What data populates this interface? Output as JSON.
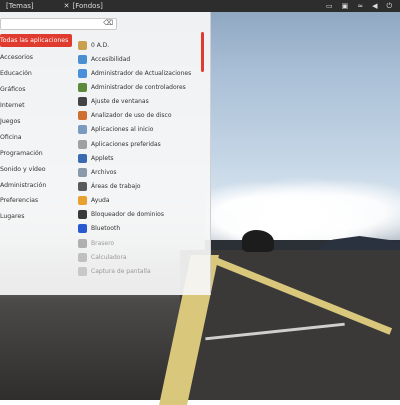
{
  "panel": {
    "tab1": "[Temas]",
    "tab2": "[Fondos]"
  },
  "menu": {
    "search_placeholder": "",
    "categories": [
      "Todas las aplicaciones",
      "Accesorios",
      "Educación",
      "Gráficos",
      "Internet",
      "Juegos",
      "Oficina",
      "Programación",
      "Sonido y vídeo",
      "Administración",
      "Preferencias",
      "Lugares"
    ],
    "apps": [
      {
        "label": "0 A.D.",
        "color": "#c8a050"
      },
      {
        "label": "Accesibilidad",
        "color": "#4a8fd0"
      },
      {
        "label": "Administrador de Actualizaciones",
        "color": "#4a90d9"
      },
      {
        "label": "Administrador de controladores",
        "color": "#5a8a3a"
      },
      {
        "label": "Ajuste de ventanas",
        "color": "#444444"
      },
      {
        "label": "Analizador de uso de disco",
        "color": "#d07030"
      },
      {
        "label": "Aplicaciones al inicio",
        "color": "#7a9ac0"
      },
      {
        "label": "Aplicaciones preferidas",
        "color": "#a0a0a0"
      },
      {
        "label": "Applets",
        "color": "#3a6ab0"
      },
      {
        "label": "Archivos",
        "color": "#8a9aa8"
      },
      {
        "label": "Áreas de trabajo",
        "color": "#5a5a5a"
      },
      {
        "label": "Ayuda",
        "color": "#e8a030"
      },
      {
        "label": "Bloqueador de dominios",
        "color": "#3a3a3a"
      },
      {
        "label": "Bluetooth",
        "color": "#2a5ad0"
      },
      {
        "label": "Brasero",
        "color": "#b0b0b0"
      },
      {
        "label": "Calculadora",
        "color": "#c0c0c0"
      },
      {
        "label": "Captura de pantalla",
        "color": "#c8c8c8"
      }
    ]
  },
  "accent_color": "#e03b2f"
}
